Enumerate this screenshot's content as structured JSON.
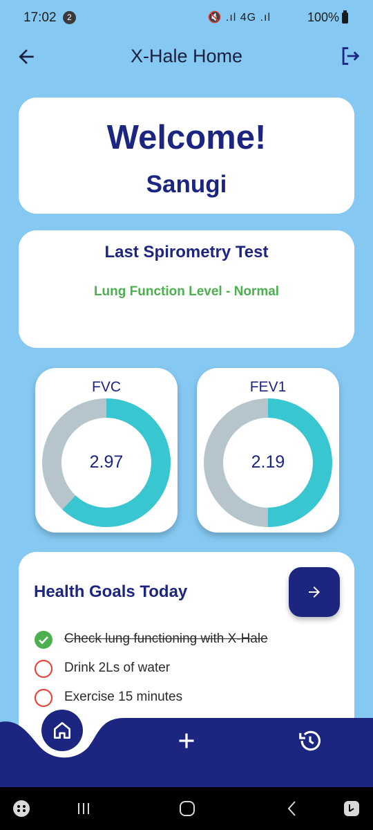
{
  "status_bar": {
    "time": "17:02",
    "notification_count": "2",
    "signal_icons": "🔇 .ıl 4G .ıl",
    "battery": "100%"
  },
  "app_bar": {
    "title": "X-Hale Home",
    "back_icon": "arrow-left-icon",
    "logout_icon": "logout-icon"
  },
  "welcome": {
    "greeting": "Welcome!",
    "name": "Sanugi"
  },
  "spirometry": {
    "title": "Last Spirometry Test",
    "level": "Lung Function Level - Normal"
  },
  "metrics": [
    {
      "label": "FVC",
      "value": "2.97",
      "fill_fraction": 0.62
    },
    {
      "label": "FEV1",
      "value": "2.19",
      "fill_fraction": 0.5
    }
  ],
  "goals": {
    "title": "Health Goals Today",
    "items": [
      {
        "text": "Check lung functioning with X-Hale",
        "done": true
      },
      {
        "text": "Drink 2Ls of water",
        "done": false
      },
      {
        "text": "Exercise 15 minutes",
        "done": false
      }
    ]
  },
  "bottom_nav": {
    "items": [
      "home-icon",
      "add-icon",
      "history-icon"
    ]
  },
  "colors": {
    "background": "#85c9f2",
    "primary": "#1c2580",
    "ring_fill": "#38c6d0",
    "ring_track": "#b6c5cb",
    "success": "#4caf50",
    "pending": "#e5483d"
  }
}
